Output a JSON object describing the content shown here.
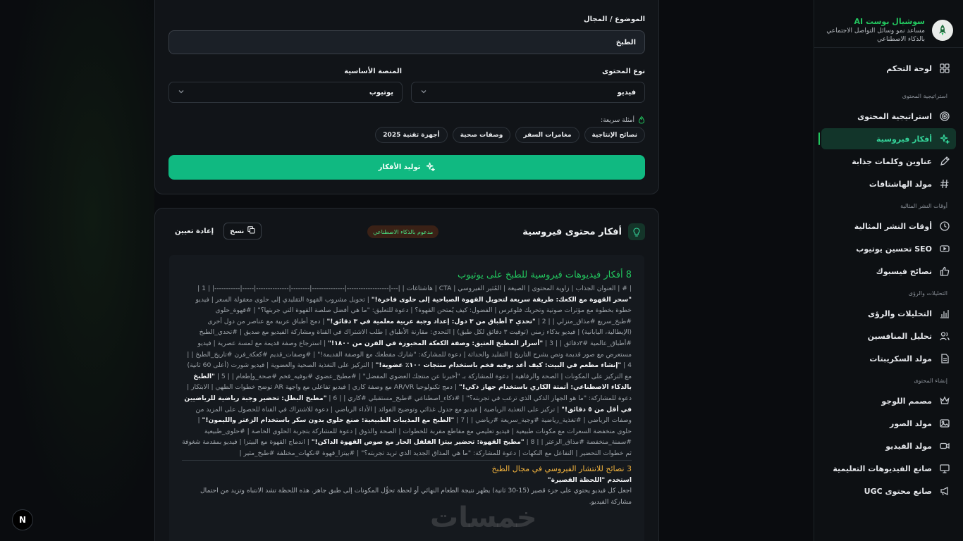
{
  "brand": {
    "name": "سوشيال بوست AI",
    "subtitle": "مساعد نمو وسائل التواصل الاجتماعي بالذكاء الاصطناعي"
  },
  "nav": {
    "dashboard": "لوحة التحكم",
    "section_strategy": "استراتيجية المحتوى",
    "strategy": "استراتيجية المحتوى",
    "viral": "أفكار فيروسية",
    "titles": "عناوين وكلمات جذابة",
    "hashtags": "مولد الهاشتاقات",
    "section_times": "أوقات النشر المثالية",
    "times": "أوقات النشر المثالية",
    "youtube_seo": "SEO تحسين يوتيوب",
    "facebook": "نصائح فيسبوك",
    "section_analytics": "التحليلات والرؤى",
    "analytics": "التحليلات والرؤى",
    "competitors": "تحليل المنافسين",
    "scripts": "مولد السكريبتات",
    "section_create": "إنشاء المحتوى",
    "logo": "مصمم اللوجو",
    "images": "مولد الصور",
    "video": "مولد الفيديو",
    "edu_video": "صانع الفيديوهات التعليمية",
    "ugc": "صانع محتوى UGC"
  },
  "form": {
    "topic_label": "الموضوع / المجال",
    "topic_value": "الطبخ",
    "content_type_label": "نوع المحتوى",
    "content_type_value": "فيديو",
    "platform_label": "المنصة الأساسية",
    "platform_value": "يوتيوب",
    "quick_examples_label": "أمثلة سريعة:",
    "chips": [
      "نصائح الإنتاجية",
      "مغامرات السفر",
      "وصفات صحية",
      "أجهزة تقنية 2025"
    ],
    "generate_button": "توليد الأفكار"
  },
  "results": {
    "title": "أفكار محتوى فيروسية",
    "badge": "مدعوم بالذكاء الاصطناعي",
    "copy_button": "نسخ",
    "reset_button": "إعادة تعيين",
    "heading1": "8 أفكار فيديوهات فيروسية للطبخ على يوتيوب",
    "table_header": "| # | العنوان الجذاب | زاوية المحتوى | الصيغة | المُثير الفيروسي | CTA | هاشتاغات |",
    "table_sep": "|---|------------------|--------------|--------|--------------|-----|-----------|",
    "rows": [
      {
        "pre": "| 1 | ",
        "title": "\"سحر القهوة مع الكعك: طريقة سريعة لتحويل القهوة الصباحية إلى حلوى فاخرة!\"",
        "post": " | تحويل مشروب القهوة التقليدي إلى حلوى معقولة السعر | فيديو خطوة بخطوة مع مؤثرات صوتية وتحريك فلوغرس | الفضول: كيف يُمتحن القهوة؟ | دعوة للتعليق: \"ما هي أفضل صلصة القهوة التي جربتها؟\" | #قهوة_حلوى #طبخ_سريع #مذاق_منزلي |"
      },
      {
        "pre": "| 2 | ",
        "title": "\"تحدي ٣ أطباق من ٣ دول: إعداد وجبة عربية معلمية في ٣ دقائق!\"",
        "post": " | دمج أطباق عربية مع عناصر من دول أخرى (الإيطالية، اليابانية) | فيديو بذكاء زمني (توقيت ٣ دقائق لكل طبق) | التحدي: مقارنة الأطباق | طلب الاشتراك في القناة ومشاركة الفيديو مع صديق | #تحدي_الطبخ #أطباق_عالمية #٣دقائق |"
      },
      {
        "pre": "| 3 | ",
        "title": "\"أسرار المطبخ العتيق: وصفة الكعكة المخبوزة في الفرن من ١٨٠٠!\"",
        "post": " | استرجاع وصفة قديمة مع لمسة عصرية | فيديو مستعرض مع صور قديمة ونص يشرح التاريخ | التقليد والحداثة | دعوة للمشاركة: \"شارك مقطعك مع الوصفة القديمة!\" | #وصفات_قديم #كعكة_فرن #تاريخ_الطبخ |"
      },
      {
        "pre": "| 4 | ",
        "title": "\"إنشاء مطعم في البيت: كيف أعد بوفيه فخم باستخدام منتجات ١٠٠٪ عضوية!\"",
        "post": " | التركيز على التغذية الصحية والعضوية | فيديو شورت (أعلى 60 ثانية) مع التركيز على المكونات | الصحة والرفاهية | دعوة للمشاركة بـ \"أخبرنا عن منتجك العضوي المفضل\" | #مطبخ_عضوي #بوفيه_فخم #صحة_وإطعام |"
      },
      {
        "pre": "| 5 | ",
        "title": "\"الطبخ بالذكاء الاصطناعي: أتمتة الكاري باستخدام جهاز ذكي!\"",
        "post": " | دمج تكنولوجيا AR/VR مع وصفة كاري | فيديو تفاعلي مع واجهة AR توضح خطوات الطهي | الابتكار | دعوة للمشاركة: \"ما هو الجهاز الذكي الذي ترغب في تجربته؟\" | #ذكاء_اصطناعي #طبخ_مستقبلي #كاري |"
      },
      {
        "pre": "| 6 | ",
        "title": "\"مطبخ البطل: تحضير وجبة رياضية للرياضيين في أقل من ٥ دقائق!\"",
        "post": " | تركيز على التغذية الرياضية | فيديو مع جدول غذائي وتوضيح الفوائد | الأداء الرياضي | دعوة للاشتراك في القناة للحصول على المزيد من وصفات الرياضي | #تغذية_رياضية #وجبة_سريعة #رياضي |"
      },
      {
        "pre": "| 7 | ",
        "title": "\"الطبخ مع المذيبات الطبيعية: صنع حلوى بدون سكر باستخدام الزعتر والليمون!\"",
        "post": " | حلوى منخفضة السعرات مع مكونات طبيعية | فيديو تعليمي مع مقاطع مقربة للخطوات | الصحة والذوق | دعوة للمشاركة بتجربة الحلوى الخاصة | #حلوى_طبيعية #سمنة_منخفضة #مذاق_الزعتر |"
      },
      {
        "pre": "| 8 | ",
        "title": "\"مطبخ القهوة: تحضير بيتزا الفلفل الحار مع صوص القهوة الداكن!\"",
        "post": " | اندماج القهوة مع البيتزا | فيديو بمقدمة شغوفة ثم خطوات التحضير | التفاعل مع النكهات | دعوة للمشاركة: \"ما هي المذاق الجديد الذي تريد تجربته؟\" | #بيتزا_قهوة #نكهات_مختلفة #طبخ_مثير |"
      }
    ],
    "heading2": "3 نصائح للانتشار الفيروسي في مجال الطبخ",
    "tip1_title": "استخدم \"اللحظة القصيرة\"",
    "tip1_text": "اجعل كل فيديو يحتوي على جزء قصير (15-30 ثانية) يظهر نتيجة الطعام النهائي أو لحظة تحوُّل المكونات إلى طبق جاهز. هذه اللحظة تشد الانتباه وتزيد من احتمال مشاركة الفيديو."
  },
  "misc": {
    "n_button": "N",
    "watermark": "خمسات"
  }
}
